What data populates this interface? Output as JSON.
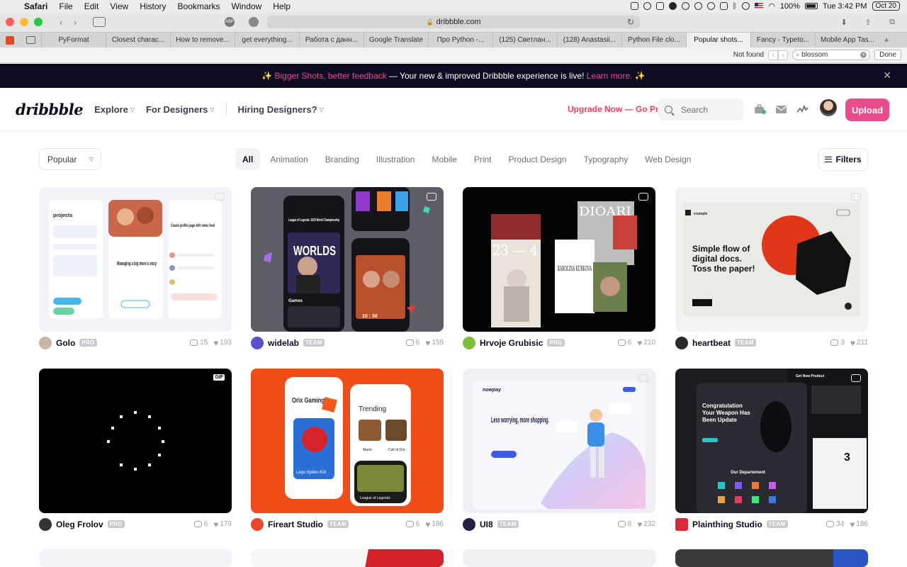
{
  "menubar": {
    "app": "Safari",
    "items": [
      "File",
      "Edit",
      "View",
      "History",
      "Bookmarks",
      "Window",
      "Help"
    ],
    "battery": "100%",
    "clock": "Tue 3:42 PM",
    "date_badge": "Oct 20"
  },
  "browser": {
    "url": "dribbble.com",
    "ext_label": "ABP",
    "tabs": [
      "PyFormat",
      "Closest charac...",
      "How to remove...",
      "get everything...",
      "Работа с данн...",
      "Google Translate",
      "Про Python -...",
      "(125) Светлан...",
      "(128) Anastasii...",
      "Python File clo...",
      "Popular shots...",
      "Fancy - Typeto...",
      "Mobile App Tas..."
    ],
    "active_tab": 10,
    "find": {
      "status": "Not found",
      "query": "blossom",
      "done_label": "Done"
    }
  },
  "banner": {
    "emoji_left": "✨",
    "highlight": "Bigger Shots, better feedback",
    "text": " — Your new & improved Dribbble experience is live! ",
    "link": "Learn more.",
    "emoji_right": "✨",
    "close": "✕"
  },
  "nav": {
    "logo": "dribbble",
    "links": [
      "Explore",
      "For Designers",
      "Hiring Designers?"
    ],
    "upgrade": "Upgrade Now — Go Pro",
    "search_placeholder": "Search",
    "upload": "Upload"
  },
  "filters": {
    "sort": "Popular",
    "categories": [
      "All",
      "Animation",
      "Branding",
      "Illustration",
      "Mobile",
      "Print",
      "Product Design",
      "Typography",
      "Web Design"
    ],
    "active_category": "All",
    "filters_label": "Filters"
  },
  "shots": [
    {
      "author": "Golo",
      "badge": "PRO",
      "comments": "15",
      "likes": "193",
      "avatar_color": "#c9b4a8",
      "media": "none"
    },
    {
      "author": "widelab",
      "badge": "TEAM",
      "comments": "6",
      "likes": "159",
      "avatar_color": "#5a4fcf",
      "media": "multi"
    },
    {
      "author": "Hrvoje Grubisic",
      "badge": "PRO",
      "comments": "6",
      "likes": "210",
      "avatar_color": "#7bbf3c",
      "media": "video"
    },
    {
      "author": "heartbeat",
      "badge": "TEAM",
      "comments": "3",
      "likes": "211",
      "avatar_color": "#2b2b2b",
      "media": "none"
    },
    {
      "author": "Oleg Frolov",
      "badge": "PRO",
      "comments": "6",
      "likes": "179",
      "avatar_color": "#333333",
      "media": "gif"
    },
    {
      "author": "Fireart Studio",
      "badge": "TEAM",
      "comments": "6",
      "likes": "186",
      "avatar_color": "#e8472b",
      "media": "none"
    },
    {
      "author": "UI8",
      "badge": "TEAM",
      "comments": "8",
      "likes": "232",
      "avatar_color": "#222244",
      "media": "none"
    },
    {
      "author": "Plainthing Studio",
      "badge": "TEAM",
      "comments": "34",
      "likes": "186",
      "avatar_color": "#d62b3a",
      "media": "multi"
    }
  ],
  "shot_text": {
    "golo_projects": "projects",
    "golo_managing": "Managing a big team is easy",
    "golo_create": "Create profile page with news feed",
    "lol_title": "League of Legends: 2020 World Championship",
    "lol_worlds": "WORLDS",
    "lol_games": "Games",
    "lol_score": "10 : 30",
    "dioari": "DIOARI",
    "num": "23 — 4",
    "karolina": "KAROLINA KURKOVA",
    "heartbeat_head": "Simple flow of digital docs. Toss the paper!",
    "heartbeat_brand": "crumple",
    "orix": "Orix Gaming",
    "trending": "Trending",
    "lego": "Lego Spider-Kid",
    "mario": "Mario",
    "cod": "Call of Dut",
    "lol_small": "League of Legends",
    "nowpay": "nowpay",
    "less": "Less worrying, more shopping.",
    "congrats": "Congratulation Your Weapon Has Been Update",
    "newproduct": "Get New Product",
    "department": "Our Departement",
    "three": "3"
  },
  "colors": {
    "accent": "#ea4c89",
    "upgrade": "#e8425f",
    "banner_bg": "#0d0c22"
  }
}
